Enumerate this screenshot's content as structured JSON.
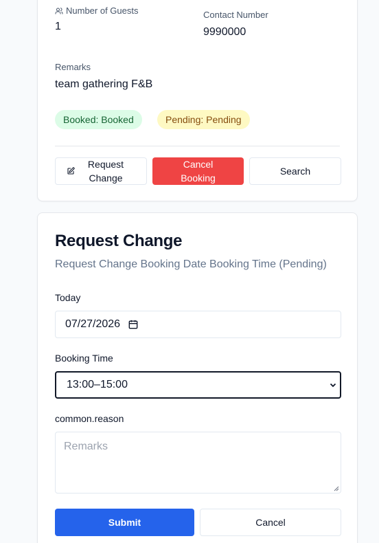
{
  "booking": {
    "guests_label": "Number of Guests",
    "guests_value": "1",
    "contact_label": "Contact Number",
    "contact_value": "9990000",
    "remarks_label": "Remarks",
    "remarks_value": "team gathering F&B",
    "badges": {
      "booked": "Booked: Booked",
      "pending": "Pending: Pending"
    },
    "actions": {
      "request_change": "Request Change",
      "cancel_booking": "Cancel Booking",
      "search": "Search"
    }
  },
  "request_form": {
    "title": "Request Change",
    "subtitle": "Request Change Booking Date Booking Time (Pending)",
    "date_label": "Today",
    "date_value": "07/27/2026",
    "time_label": "Booking Time",
    "time_value": "13:00–15:00",
    "reason_label": "common.reason",
    "reason_placeholder": "Remarks",
    "submit_label": "Submit",
    "cancel_label": "Cancel"
  },
  "colors": {
    "primary": "#2563eb",
    "danger": "#ef4444",
    "booked_bg": "#dcfce7",
    "pending_bg": "#fef9c3"
  },
  "icons": {
    "guests": "users-icon",
    "request": "edit-icon",
    "date": "calendar-icon",
    "select": "chevron-down-icon"
  }
}
